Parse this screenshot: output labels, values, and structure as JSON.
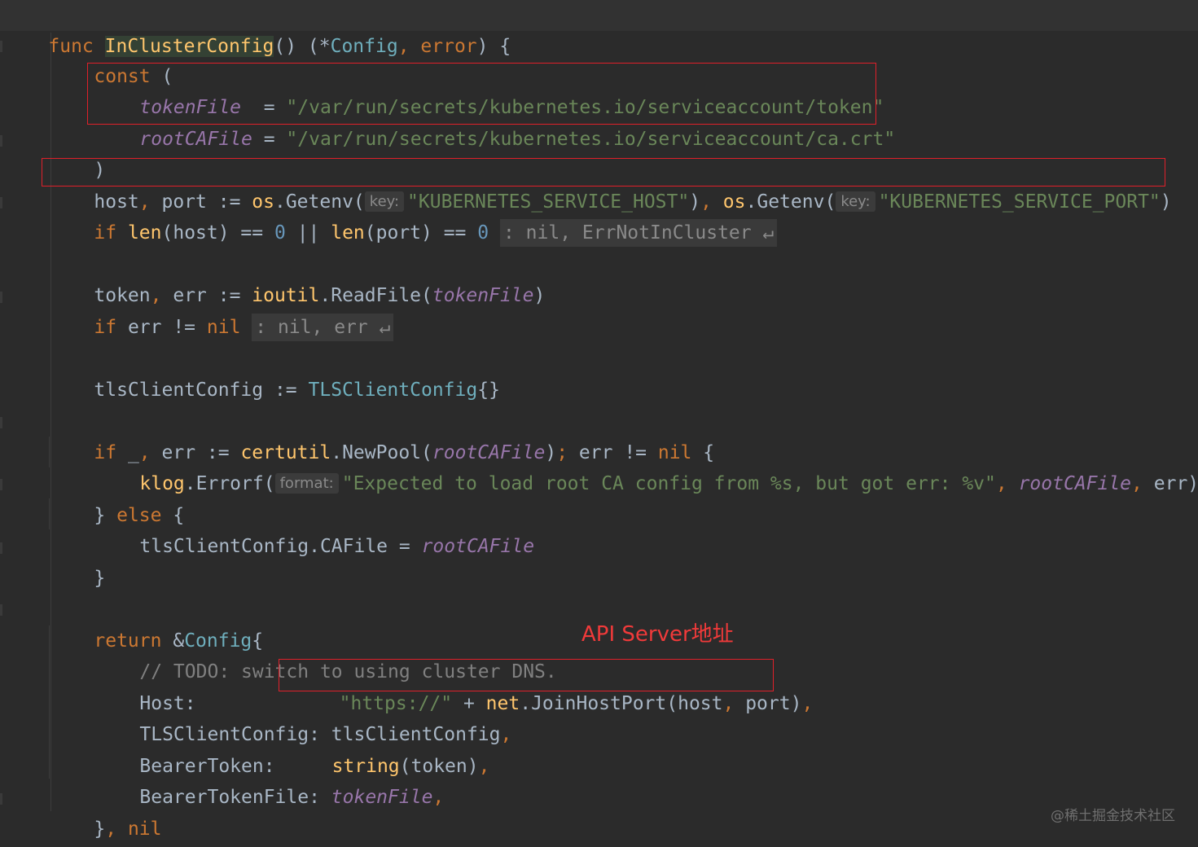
{
  "code": {
    "l1": {
      "func": "func",
      "name": "InClusterConfig",
      "sig1": "() (*",
      "ret_type": "Config",
      "comma": ", ",
      "err_type": "error",
      "sig2": ") {"
    },
    "l2": {
      "const": "const",
      "paren": " ("
    },
    "l3": {
      "name": "tokenFile",
      "eq": "  = ",
      "value": "\"/var/run/secrets/kubernetes.io/serviceaccount/token\""
    },
    "l4": {
      "name": "rootCAFile",
      "eq": " = ",
      "value": "\"/var/run/secrets/kubernetes.io/serviceaccount/ca.crt\""
    },
    "l5": {
      "paren": ")"
    },
    "l6": {
      "host": "host",
      "comma1": ", ",
      "port": "port",
      "assign": " := ",
      "os1": "os",
      "dot1": ".",
      "getenv1": "Getenv",
      "open1": "(",
      "hint1": "key:",
      "arg1": "\"KUBERNETES_SERVICE_HOST\"",
      "close1": ")",
      "comma2": ", ",
      "os2": "os",
      "dot2": ".",
      "getenv2": "Getenv",
      "open2": "(",
      "hint2": "key:",
      "arg2": "\"KUBERNETES_SERVICE_PORT\"",
      "close2": ")"
    },
    "l7": {
      "if": "if",
      "len1": "len",
      "host": "(host) == ",
      "zero1": "0",
      "or": " || ",
      "len2": "len",
      "port": "(port) == ",
      "zero2": "0",
      "fold": ": nil, ErrNotInCluster ↵"
    },
    "l8": {
      "token": "token",
      "comma": ", ",
      "err": "err := ",
      "pkg": "ioutil",
      "dot": ".",
      "fn": "ReadFile",
      "open": "(",
      "arg": "tokenFile",
      "close": ")"
    },
    "l9": {
      "if": "if",
      "cond": " err != ",
      "nil": "nil",
      "fold": ": nil, err ↵"
    },
    "l10": {
      "name": "tlsClientConfig := ",
      "type": "TLSClientConfig",
      "braces": "{}"
    },
    "l11": {
      "if": "if",
      "under": " _",
      "comma": ", ",
      "err": "err := ",
      "pkg": "certutil",
      "dot": ".",
      "fn": "NewPool",
      "open": "(",
      "arg": "rootCAFile",
      "close": ")",
      "semi": ";",
      "cond": " err != ",
      "nil": "nil",
      "brace": " {"
    },
    "l12": {
      "pkg": "klog",
      "dot": ".",
      "fn": "Errorf",
      "open": "(",
      "hint": "format:",
      "str": "\"Expected to load root CA config from %s, but got err: %v\"",
      "comma1": ", ",
      "arg1": "rootCAFile",
      "comma2": ", ",
      "arg2": "err",
      "close": ")"
    },
    "l13": {
      "brace1": "} ",
      "else": "else",
      "brace2": " {"
    },
    "l14": {
      "lhs": "tlsClientConfig.CAFile = ",
      "rhs": "rootCAFile"
    },
    "l15": {
      "brace": "}"
    },
    "l16": {
      "return": "return",
      "amp": " &",
      "type": "Config",
      "brace": "{"
    },
    "l17": {
      "comment": "// TODO: switch to using cluster DNS."
    },
    "l18": {
      "key": "Host:",
      "str": "\"https://\"",
      "plus": " + ",
      "pkg": "net",
      "dot": ".",
      "fn": "JoinHostPort",
      "args": "(host",
      "comma1": ", ",
      "args2": "port)",
      "comma2": ","
    },
    "l19": {
      "key": "TLSClientConfig: ",
      "val": "tlsClientConfig",
      "comma": ","
    },
    "l20": {
      "key": "BearerToken:",
      "fn": "string",
      "args": "(token)",
      "comma": ","
    },
    "l21": {
      "key": "BearerTokenFile: ",
      "val": "tokenFile",
      "comma": ","
    },
    "l22": {
      "brace": "}",
      "comma": ", ",
      "nil": "nil"
    },
    "l23": {
      "brace": "}"
    }
  },
  "annotation": "API Server地址",
  "watermark": "@稀土掘金技术社区",
  "colors": {
    "keyword": "#cc7832",
    "function": "#ffc66d",
    "string": "#6a8759",
    "number": "#6897bb",
    "constant": "#9876aa",
    "highlight_box": "#e0202a",
    "background": "#2b2b2b"
  }
}
